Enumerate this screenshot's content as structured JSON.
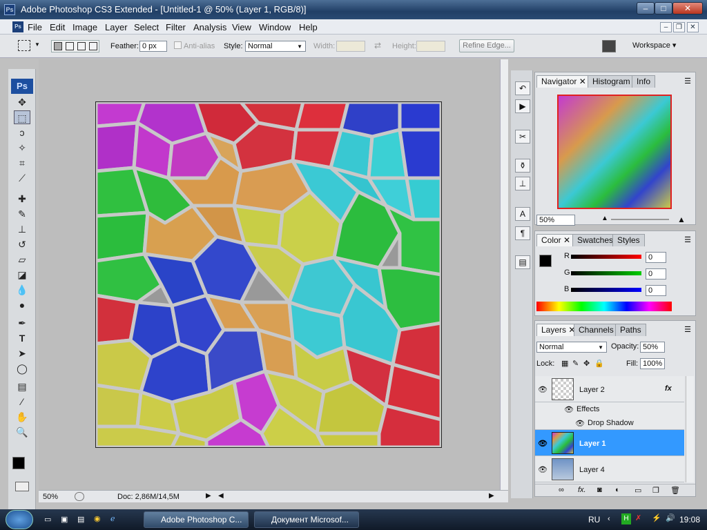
{
  "window": {
    "title": "Adobe Photoshop CS3 Extended - [Untitled-1 @ 50% (Layer 1, RGB/8)]",
    "app_icon_text": "Ps"
  },
  "menu": {
    "items": [
      "File",
      "Edit",
      "Image",
      "Layer",
      "Select",
      "Filter",
      "Analysis",
      "View",
      "Window",
      "Help"
    ]
  },
  "options": {
    "feather_label": "Feather:",
    "feather_value": "0 px",
    "antialias_label": "Anti-alias",
    "style_label": "Style:",
    "style_value": "Normal",
    "width_label": "Width:",
    "height_label": "Height:",
    "refine_edge": "Refine Edge...",
    "workspace": "Workspace ▾"
  },
  "toolbox": {
    "logo": "Ps"
  },
  "status": {
    "zoom": "50%",
    "doc": "Doc: 2,86M/14,5M"
  },
  "navigator": {
    "tabs": [
      "Navigator",
      "Histogram",
      "Info"
    ],
    "zoom": "50%"
  },
  "color": {
    "tabs": [
      "Color",
      "Swatches",
      "Styles"
    ],
    "r_label": "R",
    "g_label": "G",
    "b_label": "B",
    "r": "0",
    "g": "0",
    "b": "0"
  },
  "layers": {
    "tabs": [
      "Layers",
      "Channels",
      "Paths"
    ],
    "blend_mode": "Normal",
    "opacity_label": "Opacity:",
    "opacity": "50%",
    "lock_label": "Lock:",
    "fill_label": "Fill:",
    "fill": "100%",
    "rows": [
      {
        "name": "Layer 2",
        "fx": "fx"
      },
      {
        "name": "Effects"
      },
      {
        "name": "Drop Shadow"
      },
      {
        "name": "Layer 1"
      },
      {
        "name": "Layer 4"
      }
    ]
  },
  "taskbar": {
    "tasks": [
      "Adobe Photoshop C...",
      "Документ Microsof..."
    ],
    "lang": "RU",
    "time": "19:08"
  },
  "icons": {
    "search": "magnifier-icon",
    "eye": "eye-icon",
    "fx": "fx-icon"
  },
  "colors": {
    "accent": "#3399ff",
    "title": "#213f66"
  }
}
